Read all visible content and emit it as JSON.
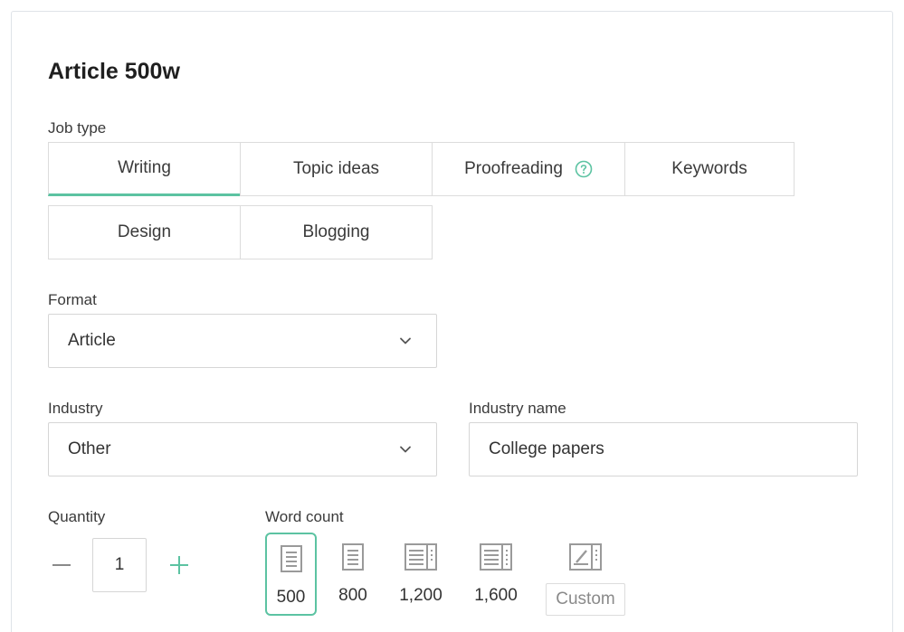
{
  "title": "Article 500w",
  "job_type": {
    "label": "Job type",
    "tabs": [
      "Writing",
      "Topic ideas",
      "Proofreading",
      "Keywords",
      "Design",
      "Blogging"
    ],
    "active": "Writing"
  },
  "format": {
    "label": "Format",
    "value": "Article"
  },
  "industry": {
    "label": "Industry",
    "value": "Other"
  },
  "industry_name": {
    "label": "Industry name",
    "value": "College papers"
  },
  "quantity": {
    "label": "Quantity",
    "value": "1"
  },
  "word_count": {
    "label": "Word count",
    "options": [
      "500",
      "800",
      "1,200",
      "1,600"
    ],
    "custom_label": "Custom",
    "selected": "500"
  },
  "colors": {
    "accent": "#5cc3a2",
    "border": "#dcdcdc",
    "icon_gray": "#9a9a9a"
  }
}
